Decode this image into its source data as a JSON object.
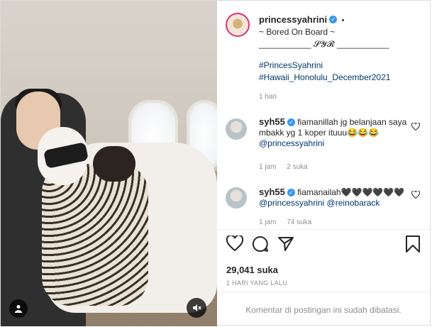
{
  "post": {
    "author": "princessyahrini",
    "follow_dot": "•",
    "caption_lines": [
      "~ Bored On Board ~",
      "___________ 𝓢𝓨𝓡 ___________"
    ],
    "hashtags": [
      "#PrincesSyahrini",
      "#Hawaii_Honolulu_December2021"
    ],
    "caption_time": "1 hari"
  },
  "comments": [
    {
      "user": "syh55",
      "text_plain": "fiamanillah jg belanjaan saya mbakk yg 1 koper ituuu😂😂😂",
      "mention": "@princessyahrini",
      "time": "1 jam",
      "likes": "2 suka"
    },
    {
      "user": "syh55",
      "text_plain": "fiamanailah🖤🖤🖤🖤🖤🖤",
      "mention": "@princessyahrini @reinobarack",
      "time": "1 jam",
      "likes": "74 suka"
    }
  ],
  "stats": {
    "likes": "29,041 suka",
    "time_ago": "1 HARI YANG LALU"
  },
  "footer": {
    "comments_closed": "Komentar di postingan ini sudah dibatasi."
  },
  "icons": {
    "verified": "verified-badge-icon",
    "like": "heart-icon",
    "comment": "comment-icon",
    "share": "send-icon",
    "save": "bookmark-icon",
    "tag_user": "user-icon",
    "mute": "speaker-muted-icon"
  },
  "colors": {
    "link": "#00376b",
    "verified": "#3897f0",
    "muted_text": "#8e8e8e",
    "story_ring": "#e1306c"
  }
}
